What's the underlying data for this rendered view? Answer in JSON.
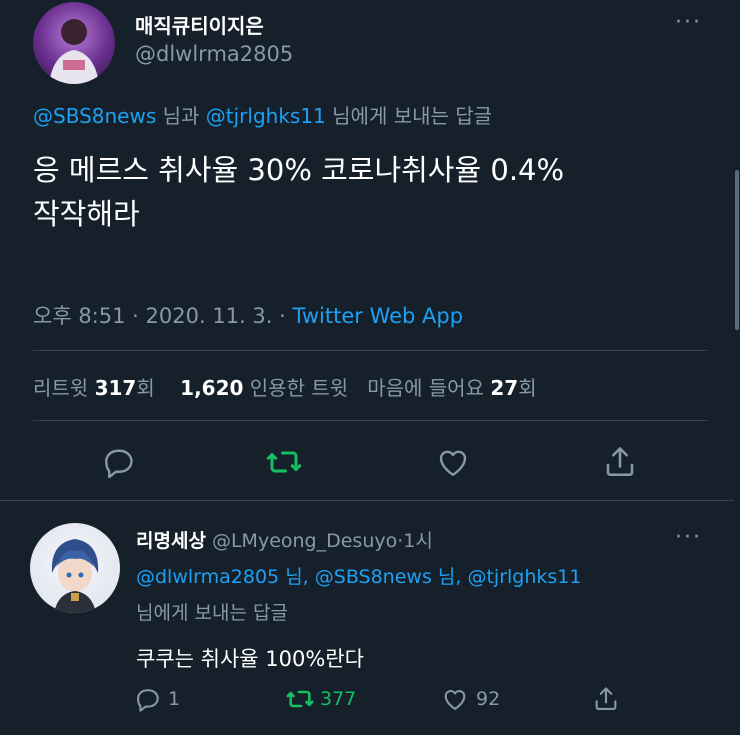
{
  "tweet": {
    "display_name": "매직큐티이지은",
    "handle": "@dlwlrma2805",
    "reply_context": {
      "mention1": "@SBS8news",
      "joiner": "님과",
      "mention2": "@tjrlghks11",
      "suffix": "님에게 보내는 답글"
    },
    "text_line1": "응 메르스 취사율 30% 코로나취사율 0.4%",
    "text_line2": "작작해라",
    "time": "오후 8:51",
    "date": "2020. 11. 3.",
    "sep1": "·",
    "sep2": "·",
    "source": "Twitter Web App",
    "stats": {
      "retweet_label": "리트윗",
      "retweet_count": "317",
      "retweet_unit": "회",
      "quote_count": "1,620",
      "quote_label": "인용한 트윗",
      "like_label": "마음에 들어요",
      "like_count": "27",
      "like_unit": "회"
    },
    "more": "···"
  },
  "reply": {
    "display_name": "리명세상",
    "handle": "@LMyeong_Desuyo",
    "sep": "·",
    "time": "1시",
    "mentions_line": {
      "m1": "@dlwlrma2805",
      "j1": "님,",
      "m2": "@SBS8news",
      "j2": "님,",
      "m3": "@tjrlghks11"
    },
    "reply_suffix": "님에게 보내는 답글",
    "text": "쿠쿠는 취사율 100%란다",
    "reply_count": "1",
    "retweet_count": "377",
    "like_count": "92",
    "more": "···"
  },
  "colors": {
    "background": "#15202b",
    "link": "#1da1f2",
    "muted": "#8899a6",
    "retweet_green": "#17bf63",
    "divider": "#38444d"
  },
  "icons": [
    "reply-icon",
    "retweet-icon",
    "like-icon",
    "share-icon",
    "more-icon"
  ]
}
